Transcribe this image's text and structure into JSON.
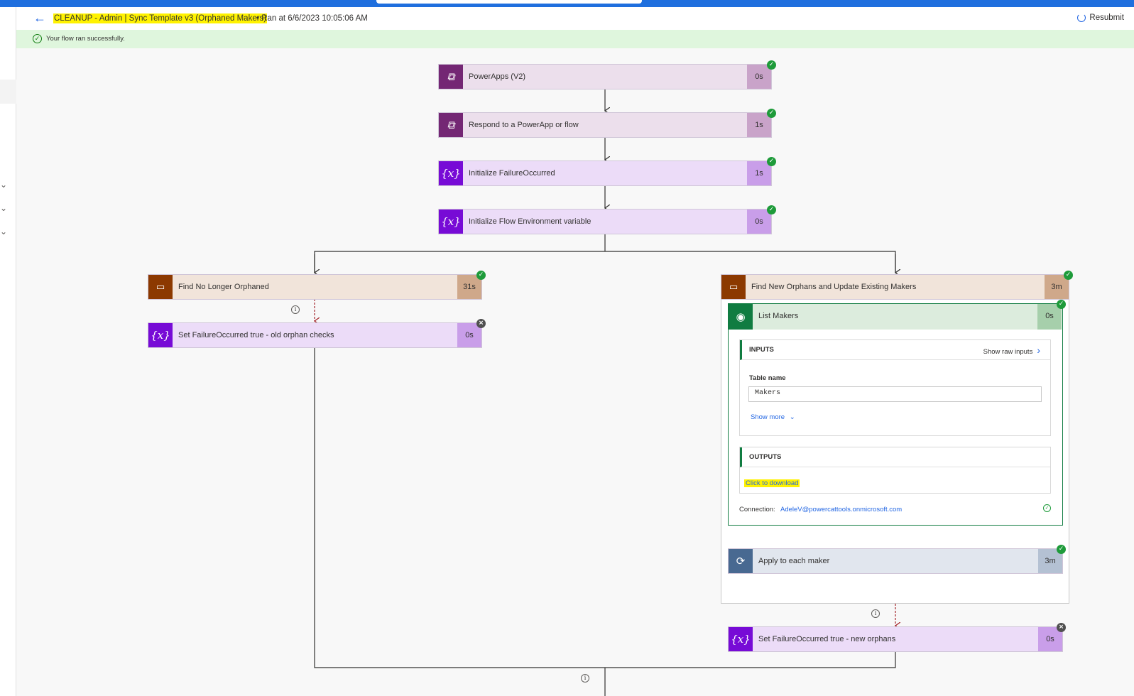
{
  "header": {
    "back_icon": "arrow-left-icon",
    "flow_title": "CLEANUP - Admin | Sync Template v3 (Orphaned Makers)",
    "run_info": "• Ran at 6/6/2023 10:05:06 AM",
    "resubmit_label": "Resubmit"
  },
  "banner": {
    "message": "Your flow ran successfully."
  },
  "steps": {
    "powerapps": {
      "label": "PowerApps (V2)",
      "duration": "0s",
      "icon": "powerapps-icon"
    },
    "respond": {
      "label": "Respond to a PowerApp or flow",
      "duration": "1s",
      "icon": "powerapps-icon"
    },
    "init_failure": {
      "label": "Initialize FailureOccurred",
      "duration": "1s",
      "icon": "variable-icon"
    },
    "init_env": {
      "label": "Initialize Flow Environment variable",
      "duration": "0s",
      "icon": "variable-icon"
    },
    "find_no_longer": {
      "label": "Find No Longer Orphaned",
      "duration": "31s",
      "icon": "scope-icon"
    },
    "set_old": {
      "label": "Set FailureOccurred true - old orphan checks",
      "duration": "0s",
      "icon": "variable-icon"
    },
    "find_new": {
      "label": "Find New Orphans and Update Existing Makers",
      "duration": "3m",
      "icon": "scope-icon"
    },
    "list_makers": {
      "label": "List Makers",
      "duration": "0s",
      "icon": "dataverse-icon"
    },
    "apply_each": {
      "label": "Apply to each maker",
      "duration": "3m",
      "icon": "loop-icon"
    },
    "set_new": {
      "label": "Set FailureOccurred true - new orphans",
      "duration": "0s",
      "icon": "variable-icon"
    }
  },
  "list_makers_detail": {
    "inputs_title": "INPUTS",
    "show_raw_inputs": "Show raw inputs",
    "table_name_label": "Table name",
    "table_name_value": "Makers",
    "show_more": "Show more",
    "outputs_title": "OUTPUTS",
    "click_to_download": "Click to download",
    "connection_label": "Connection:",
    "connection_value": "AdeleV@powercattools.onmicrosoft.com"
  },
  "colors": {
    "accent": "#2266e3",
    "success": "#1e9b3a",
    "powerapps": "#742774",
    "variable": "#770bd6",
    "scope": "#8c3900",
    "dataverse": "#107c41",
    "loop": "#486991",
    "highlight": "#fff200"
  }
}
